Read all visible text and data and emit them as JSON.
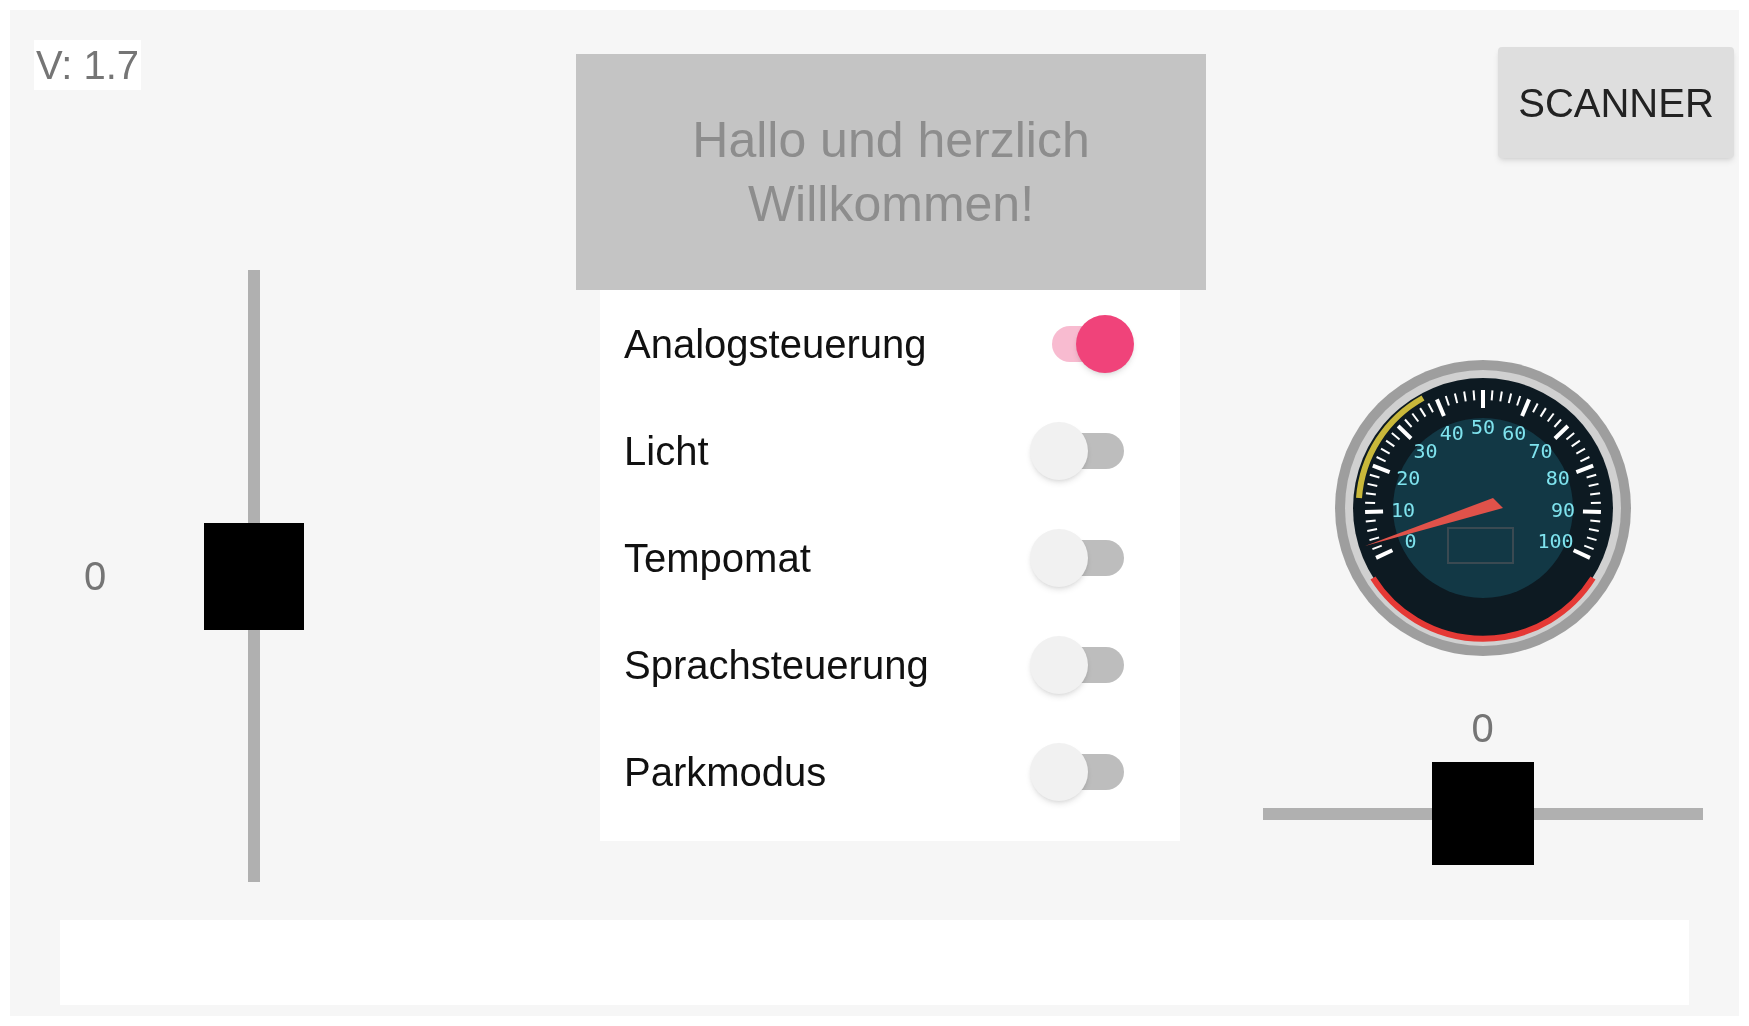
{
  "version": "V: 1.7",
  "banner": "Hallo und herzlich Willkommen!",
  "scanner_button": "SCANNER",
  "left_slider": {
    "reading": "0",
    "level": 0.5
  },
  "toggles": [
    {
      "label": "Analogsteuerung",
      "on": true
    },
    {
      "label": "Licht",
      "on": false
    },
    {
      "label": "Tempomat",
      "on": false
    },
    {
      "label": "Sprachsteuerung",
      "on": false
    },
    {
      "label": "Parkmodus",
      "on": false
    }
  ],
  "gauge": {
    "left_labels": [
      "40",
      "30",
      "20",
      "10",
      "0"
    ],
    "right_labels": [
      "50",
      "60",
      "70",
      "80",
      "90",
      "100"
    ]
  },
  "right_slider": {
    "reading": "0",
    "level": 0.5
  }
}
